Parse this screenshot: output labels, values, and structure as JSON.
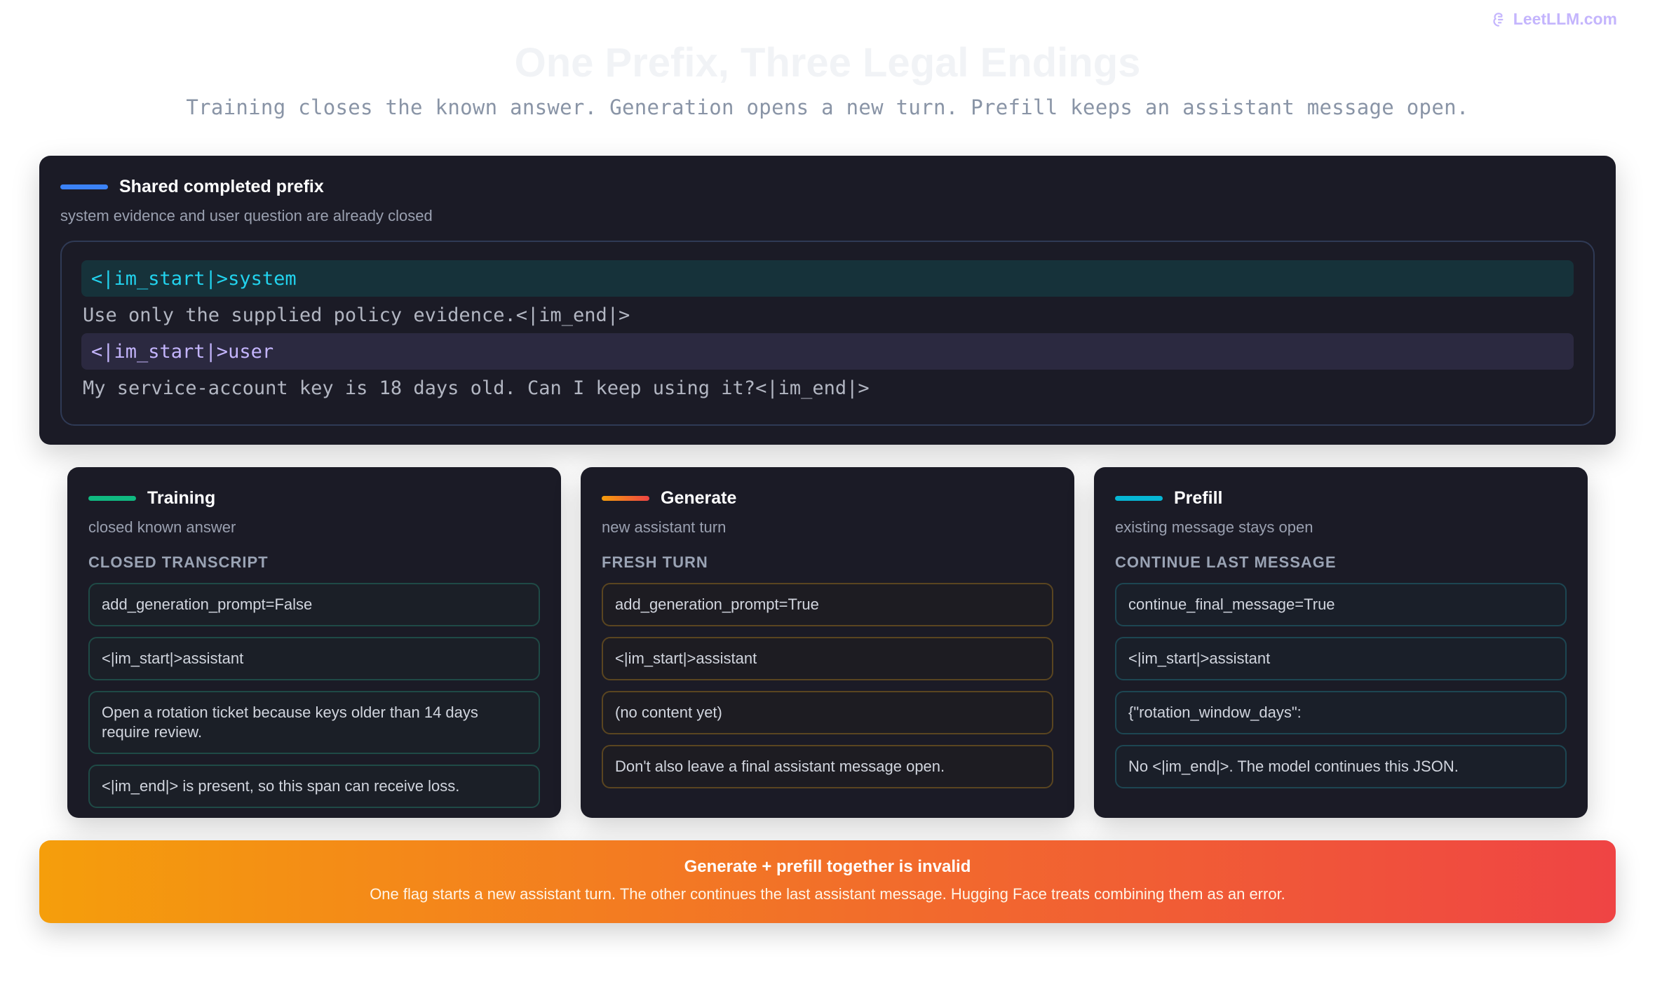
{
  "brand": {
    "name": "LeetLLM.com",
    "icon": "brain-icon"
  },
  "title": "One Prefix, Three Legal Endings",
  "subtitle": "Training closes the known answer. Generation opens a new turn. Prefill keeps an assistant message open.",
  "shared": {
    "title": "Shared completed prefix",
    "subtitle": "system evidence and user question are already closed",
    "accent_color": "#3b82f6",
    "lines": [
      "<|im_start|>system",
      "Use only the supplied policy evidence.<|im_end|>",
      "<|im_start|>user",
      "My service-account key is 18 days old. Can I keep using it?<|im_end|>"
    ]
  },
  "columns": [
    {
      "title": "Training",
      "subtitle": "closed known answer",
      "section": "CLOSED TRANSCRIPT",
      "accent_color": "#10b981",
      "steps": [
        "add_generation_prompt=False",
        "<|im_start|>assistant",
        "Open a rotation ticket because keys older than 14 days require review.",
        "<|im_end|> is present, so this span can receive loss."
      ]
    },
    {
      "title": "Generate",
      "subtitle": "new assistant turn",
      "section": "FRESH TURN",
      "accent_color": "#f97316",
      "steps": [
        "add_generation_prompt=True",
        "<|im_start|>assistant",
        "(no content yet)",
        "Don't also leave a final assistant message open."
      ]
    },
    {
      "title": "Prefill",
      "subtitle": "existing message stays open",
      "section": "CONTINUE LAST MESSAGE",
      "accent_color": "#06b6d4",
      "steps": [
        "continue_final_message=True",
        "<|im_start|>assistant",
        "{\"rotation_window_days\":",
        "No <|im_end|>. The model continues this JSON."
      ]
    }
  ],
  "banner": {
    "title": "Generate + prefill together is invalid",
    "text": "One flag starts a new assistant turn. The other continues the last assistant message. Hugging Face treats combining them as an error."
  }
}
